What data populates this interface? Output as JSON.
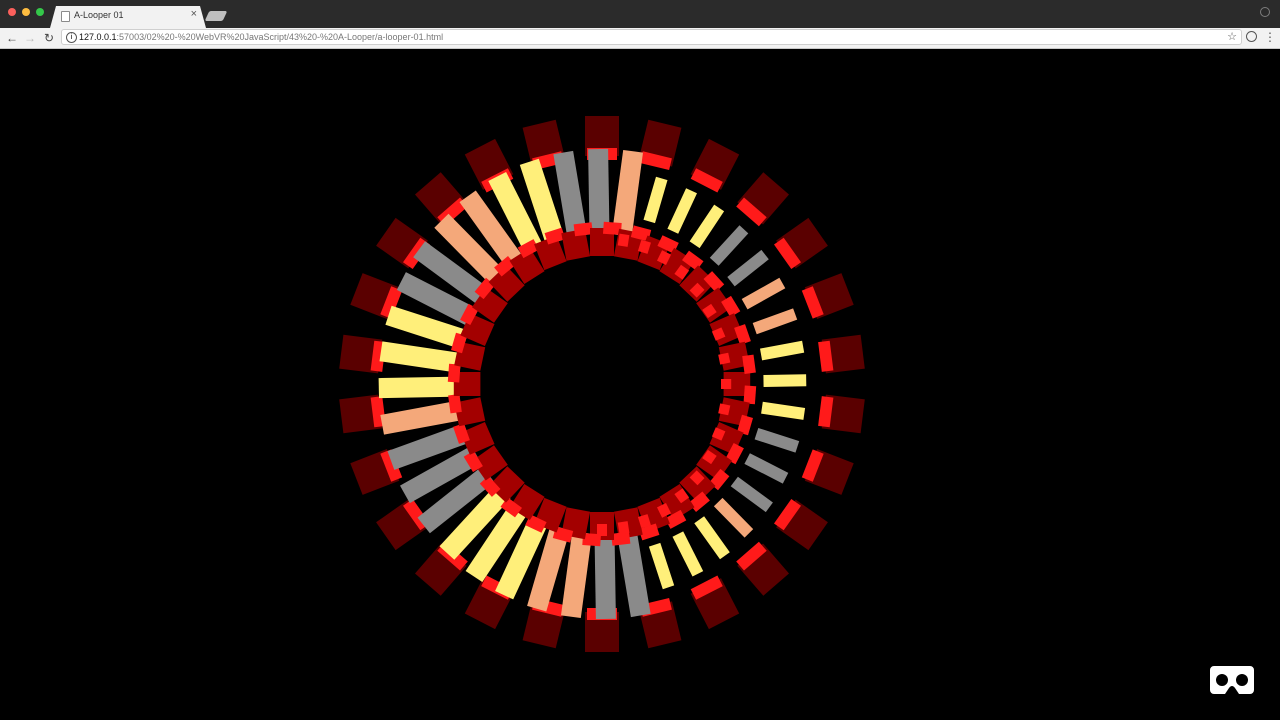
{
  "browser": {
    "tab": {
      "title": "A-Looper 01"
    },
    "tab_close_glyph": "×",
    "url": {
      "host": "127.0.0.1",
      "path": ":57003/02%20-%20WebVR%20JavaScript/43%20-%20A-Looper/a-looper-01.html"
    },
    "icons": {
      "back": "←",
      "forward": "→",
      "reload": "↻",
      "info": "i",
      "star": "☆",
      "menu": "⋮"
    }
  },
  "scene": {
    "background": "#000000",
    "colors": {
      "red_bright": "#ff1a1a",
      "red_dark": "#5a0000",
      "red_mid": "#a30000",
      "yellow": "#ffef7a",
      "peach": "#f4a87a",
      "gray": "#8a8a8a",
      "white": "#ffffff"
    }
  }
}
